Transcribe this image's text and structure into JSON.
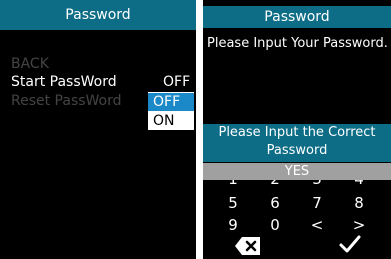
{
  "left": {
    "title": "Password",
    "menu": {
      "back": "BACK",
      "start": "Start PassWord",
      "reset": "Reset PassWord"
    },
    "current_value": "OFF",
    "popup": {
      "options": [
        "OFF",
        "ON"
      ],
      "selected": "OFF"
    }
  },
  "right": {
    "title": "Password",
    "prompt": "Please Input Your Password.",
    "alert": "Please Input the Correct Password",
    "confirm_button": "YES",
    "keypad": {
      "row1": [
        "5",
        "6",
        "7",
        "8"
      ],
      "row2": [
        "9",
        "0",
        "<",
        ">"
      ],
      "backspace_icon": "backspace-icon",
      "confirm_icon": "checkmark-icon"
    }
  },
  "colors": {
    "titlebar": "#0d6d86",
    "selected": "#1b88c8",
    "background": "#000000",
    "yes_bar": "#a0a0a0"
  }
}
